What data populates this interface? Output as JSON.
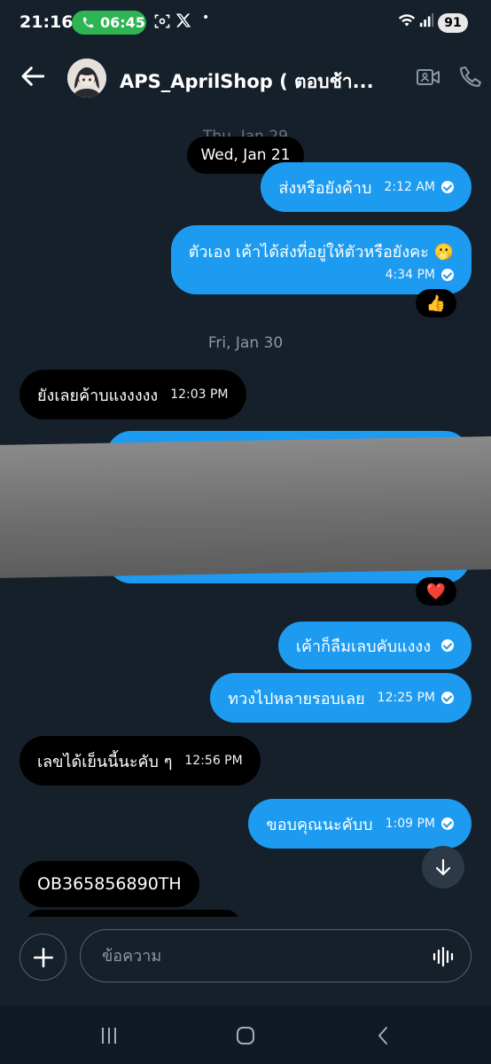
{
  "status_bar": {
    "time": "21:16",
    "call_timer": "06:45",
    "battery": "91"
  },
  "header": {
    "contact_name": "APS_AprilShop ( ตอบช้า...",
    "accent": "#1d9bf0"
  },
  "chat": {
    "floating_date_behind": "Thu, Jan 29",
    "floating_date": "Wed, Jan 21",
    "date_separator": "Fri, Jan 30",
    "messages": [
      {
        "dir": "out",
        "text": "ส่งหรือยังค้าบ",
        "time": "2:12 AM"
      },
      {
        "dir": "out",
        "text": "ตัวเอง เค้าได้ส่งที่อยู่ให้ตัวหรือยังคะ 🫢",
        "time": "4:34 PM",
        "reaction": "👍"
      },
      {
        "dir": "in",
        "text": "ยังเลยค้าบแงงงงง",
        "time": "12:03 PM"
      },
      {
        "dir": "out",
        "text": "",
        "time": "",
        "reaction": "❤️",
        "note": "redacted"
      },
      {
        "dir": "out",
        "text": "เค้าก็ลืมเลบคับแงงง",
        "time": ""
      },
      {
        "dir": "out",
        "text": "ทวงไปหลายรอบเลย",
        "time": "12:25 PM"
      },
      {
        "dir": "in",
        "text": "เลขได้เย็นนี้นะคับ ๆ",
        "time": "12:56 PM"
      },
      {
        "dir": "out",
        "text": "ขอบคุณนะคับบ",
        "time": "1:09 PM"
      },
      {
        "dir": "in",
        "text": "OB365856890TH",
        "time": ""
      }
    ]
  },
  "composer": {
    "placeholder": "ข้อความ"
  }
}
